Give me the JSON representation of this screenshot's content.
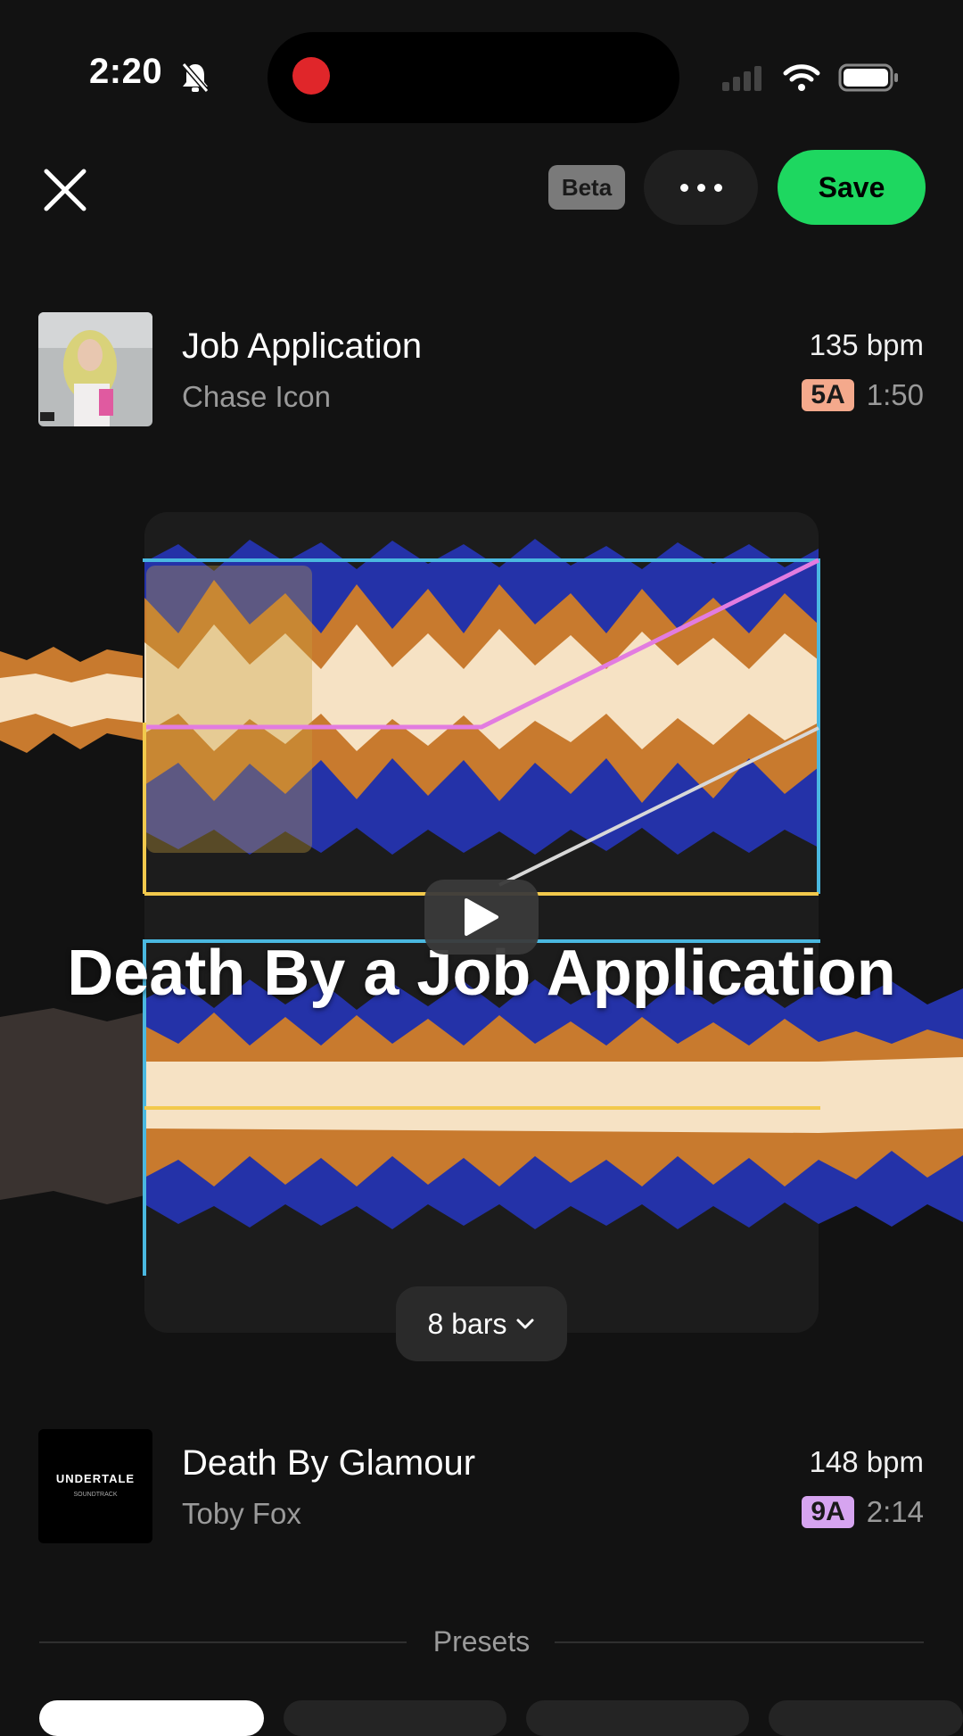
{
  "status_bar": {
    "time": "2:20"
  },
  "header": {
    "beta_label": "Beta",
    "save_label": "Save"
  },
  "track_a": {
    "title": "Job Application",
    "artist": "Chase Icon",
    "bpm": "135 bpm",
    "key": "5A",
    "key_color": "#f4a98c",
    "duration": "1:50"
  },
  "mix": {
    "title": "Death By a Job Application",
    "bars_label": "8 bars"
  },
  "track_b": {
    "title": "Death By Glamour",
    "artist": "Toby Fox",
    "bpm": "148 bpm",
    "key": "9A",
    "key_color": "#d6a4f0",
    "duration": "2:14",
    "art_text": "UNDERTALE",
    "art_subtext": "SOUNDTRACK"
  },
  "presets": {
    "label": "Presets"
  },
  "colors": {
    "accent": "#1ed760",
    "wave_cream": "#f6e2c4",
    "wave_orange": "#c87a2e",
    "wave_brown": "#7a4520",
    "wave_blue": "#2432a8",
    "blue_line": "#4ab8e0",
    "yellow_line": "#f2c94c",
    "pink_line": "#e27ce0"
  }
}
